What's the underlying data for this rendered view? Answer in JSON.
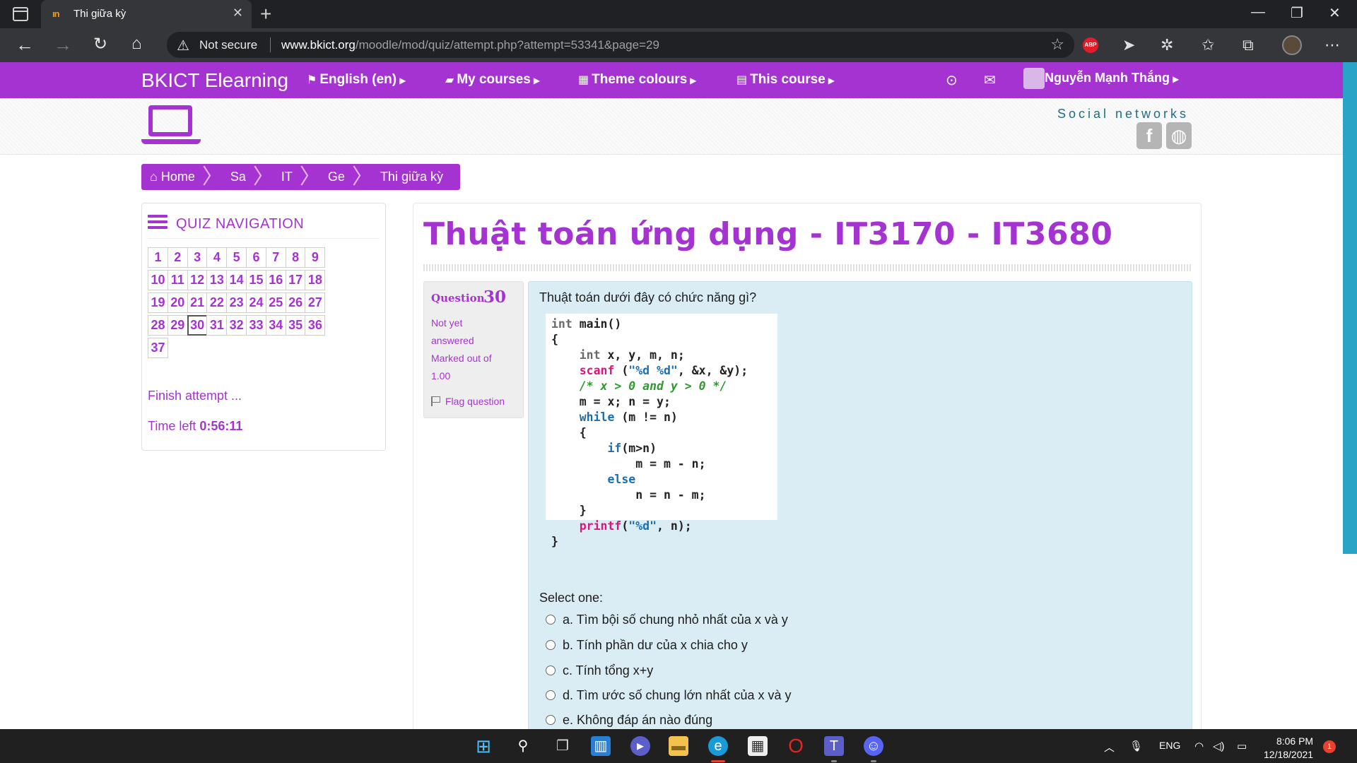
{
  "browser": {
    "tab_title": "Thi giữa kỳ",
    "tab_favicon": "moodle-icon",
    "not_secure": "Not secure",
    "url_host": "www.bkict.org",
    "url_path": "/moodle/mod/quiz/attempt.php?attempt=53341&page=29"
  },
  "moodle": {
    "brand": "BKICT Elearning",
    "menus": [
      {
        "icon": "flag-icon",
        "label": "English (en)"
      },
      {
        "icon": "briefcase-icon",
        "label": "My courses"
      },
      {
        "icon": "grid-icon",
        "label": "Theme colours"
      },
      {
        "icon": "book-icon",
        "label": "This course"
      }
    ],
    "user_name": "Nguyễn Mạnh Thắng",
    "social_title": "Social networks",
    "social_links": [
      "facebook-icon",
      "globe-icon"
    ]
  },
  "breadcrumb": [
    "Home",
    "Sa",
    "IT",
    "Ge",
    "Thi giữa kỳ"
  ],
  "quiz_nav": {
    "title": "QUIZ NAVIGATION",
    "questions": [
      "1",
      "2",
      "3",
      "4",
      "5",
      "6",
      "7",
      "8",
      "9",
      "10",
      "11",
      "12",
      "13",
      "14",
      "15",
      "16",
      "17",
      "18",
      "19",
      "20",
      "21",
      "22",
      "23",
      "24",
      "25",
      "26",
      "27",
      "28",
      "29",
      "30",
      "31",
      "32",
      "33",
      "34",
      "35",
      "36",
      "37"
    ],
    "current": "30",
    "finish_label": "Finish attempt ...",
    "time_left_label": "Time left",
    "time_left_value": "0:56:11"
  },
  "quiz": {
    "title": "Thuật toán ứng dụng - IT3170 - IT3680",
    "question_label": "Question",
    "question_number": "30",
    "state_line1": "Not yet",
    "state_line2": "answered",
    "grade_line1": "Marked out of",
    "grade_line2": "1.00",
    "flag_label": "Flag question",
    "question_text": "Thuật toán dưới đây có chức năng gì?",
    "code": {
      "l01a": "int",
      "l01b": " main()",
      "l02": "{",
      "l03a": "    int",
      "l03b": " x, y, m, n;",
      "l04a": "    scanf",
      "l04b": " (",
      "l04c": "\"%d %d\"",
      "l04d": ", &x, &y);",
      "l05": "    /* x > 0 and y > 0 */",
      "l06": "    m = x; n = y;",
      "l07a": "    while",
      "l07b": " (m != n)",
      "l08": "    {",
      "l09a": "        if",
      "l09b": "(m>n)",
      "l10": "            m = m - n;",
      "l11a": "        else",
      "l12": "            n = n - m;",
      "l13": "    }",
      "l14a": "    printf",
      "l14b": "(",
      "l14c": "\"%d\"",
      "l14d": ", n);",
      "l15": "}"
    },
    "select_one": "Select one:",
    "options": [
      "a. Tìm bội số chung nhỏ nhất của x và y",
      "b. Tính phần dư của x chia cho y",
      "c. Tính tổng x+y",
      "d. Tìm ước số chung lớn nhất của x và y",
      "e. Không đáp án nào đúng"
    ]
  },
  "taskbar": {
    "lang": "ENG",
    "time": "8:06 PM",
    "date": "12/18/2021",
    "notifications": "1"
  }
}
